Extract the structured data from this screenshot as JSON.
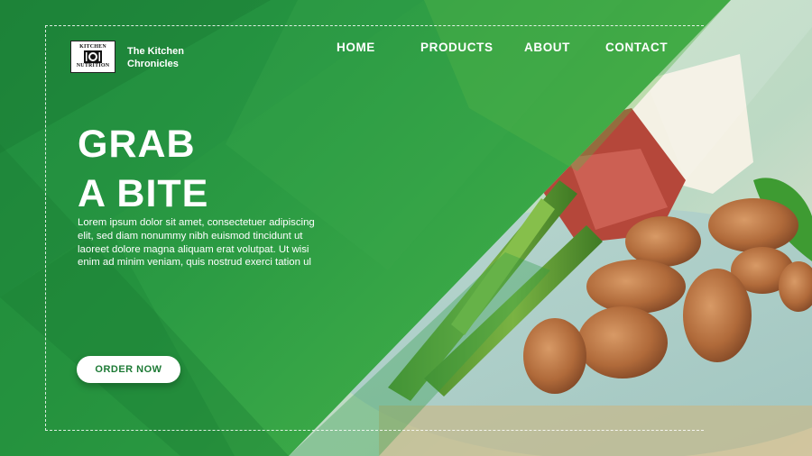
{
  "brand": {
    "logo_top": "KITCHEN",
    "logo_bottom": "NUTRITION",
    "name": "The Kitchen Chronicles"
  },
  "nav": {
    "items": [
      {
        "label": "HOME"
      },
      {
        "label": "PRODUCTS"
      },
      {
        "label": "ABOUT"
      },
      {
        "label": "CONTACT"
      }
    ]
  },
  "hero": {
    "headline_line1": "GRAB",
    "headline_line2": "A BITE",
    "body": "Lorem ipsum dolor sit amet, consectetuer adipiscing elit, sed diam nonummy nibh euismod tincidunt ut laoreet dolore magna aliquam erat volutpat. Ut wisi enim ad minim veniam, quis nostrud exerci tation ul",
    "cta_label": "ORDER NOW"
  },
  "colors": {
    "primary_green": "#2a9a43",
    "dark_green": "#1f8a3b",
    "light_green": "#67b842",
    "cta_text": "#1d7a35"
  }
}
